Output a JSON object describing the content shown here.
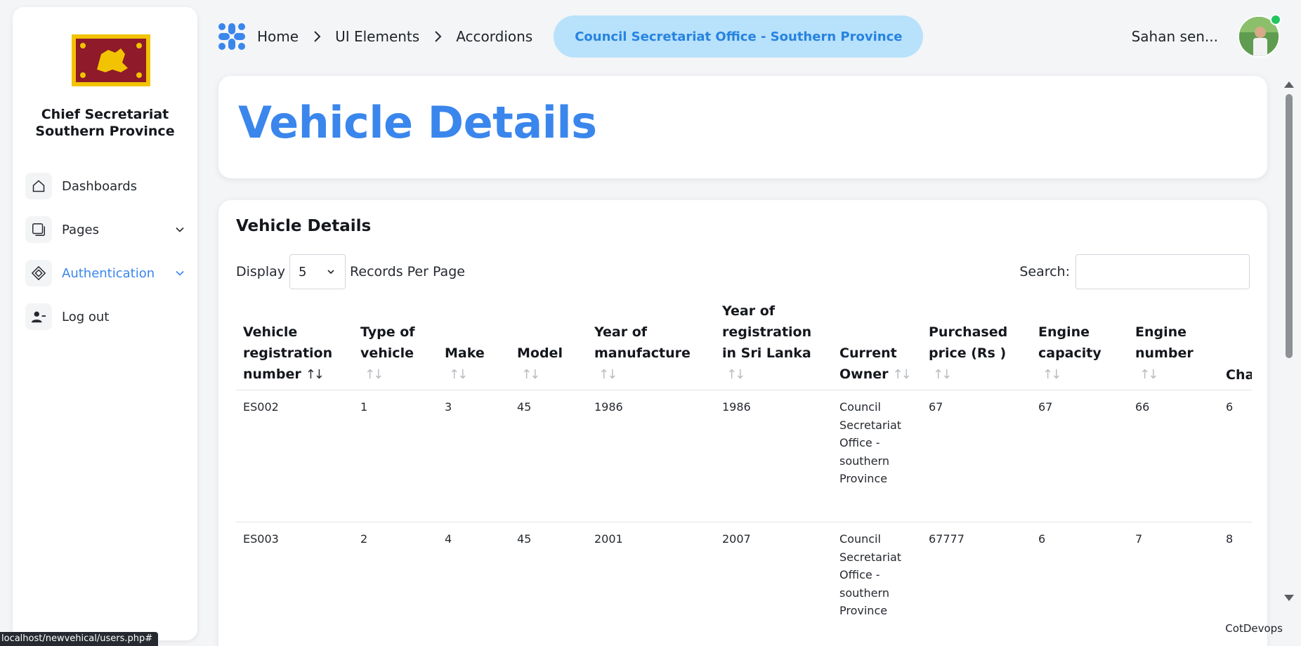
{
  "sidebar": {
    "org_line1": "Chief Secretariat",
    "org_line2": "Southern Province",
    "items": [
      {
        "label": "Dashboards",
        "icon": "home-icon"
      },
      {
        "label": "Pages",
        "icon": "pages-icon"
      },
      {
        "label": "Authentication",
        "icon": "diamond-icon"
      },
      {
        "label": "Log out",
        "icon": "user-minus-icon"
      }
    ]
  },
  "header": {
    "breadcrumb": [
      "Home",
      "UI Elements",
      "Accordions"
    ],
    "office_pill": "Council Secretariat Office - Southern Province",
    "user_name": "Sahan sen..."
  },
  "page": {
    "title": "Vehicle Details"
  },
  "table_card": {
    "title": "Vehicle Details",
    "display_label": "Display",
    "records_per_page_label": "Records Per Page",
    "page_size": "5",
    "search_label": "Search:",
    "search_value": "",
    "columns": [
      "Vehicle registration number",
      "Type of vehicle",
      "Make",
      "Model",
      "Year of manufacture",
      "Year of registration in Sri Lanka",
      "Current Owner",
      "Purchased price (Rs )",
      "Engine capacity",
      "Engine number",
      "Chassis number"
    ],
    "rows": [
      [
        "ES002",
        "1",
        "3",
        "45",
        "1986",
        "1986",
        "Council Secretariat Office - southern Province",
        "67",
        "67",
        "66",
        "6"
      ],
      [
        "ES003",
        "2",
        "4",
        "45",
        "2001",
        "2007",
        "Council Secretariat Office - southern Province",
        "67777",
        "6",
        "7",
        "8"
      ]
    ]
  },
  "footer": {
    "brand": "CotDevops",
    "status_url": "localhost/newvehical/users.php#"
  },
  "colors": {
    "accent": "#3a86ec",
    "pill_bg": "#b8e1fb",
    "online": "#22c55e"
  }
}
